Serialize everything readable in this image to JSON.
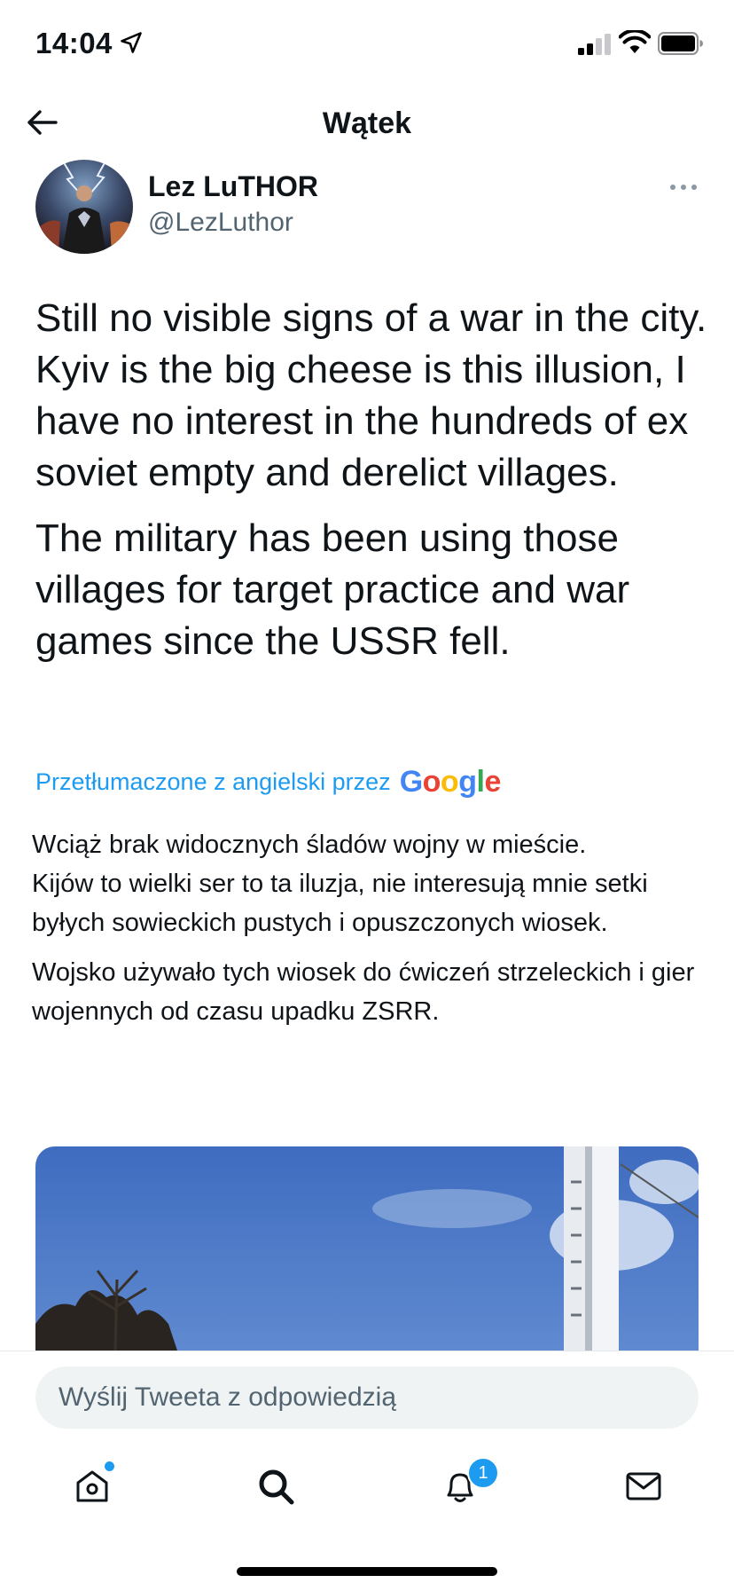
{
  "status_bar": {
    "time": "14:04",
    "icons": [
      "location-arrow-icon",
      "signal-icon",
      "wifi-icon",
      "battery-icon"
    ]
  },
  "nav": {
    "title": "Wątek",
    "back_icon": "arrow-left-icon"
  },
  "tweet": {
    "author_name": "Lez LuTHOR",
    "author_handle": "@LezLuthor",
    "more_icon": "more-dots-icon",
    "paragraphs": [
      "Still no visible signs of a war in the city.\nKyiv is the big cheese is this illusion, I have no interest in the hundreds of ex soviet empty and derelict villages.",
      "The military has been using those villages for target practice and war games since the USSR fell."
    ],
    "translated_by": "Przetłumaczone z angielski przez",
    "google_logo": "Google",
    "translation": [
      "Wciąż brak widocznych śladów wojny w mieście.\n Kijów to wielki ser to ta iluzja, nie interesują mnie setki byłych sowieckich pustych i opuszczonych wiosek.",
      " Wojsko używało tych wiosek do ćwiczeń strzeleckich i gier wojennych od czasu upadku ZSRR."
    ]
  },
  "reply": {
    "placeholder": "Wyślij Tweeta z odpowiedzią"
  },
  "tabbar": {
    "tabs": [
      "home-icon",
      "search-icon",
      "bell-icon",
      "mail-icon"
    ],
    "notifications_badge": "1"
  },
  "colors": {
    "accent": "#1d9bf0",
    "text": "#0f1419",
    "secondary": "#536471"
  }
}
